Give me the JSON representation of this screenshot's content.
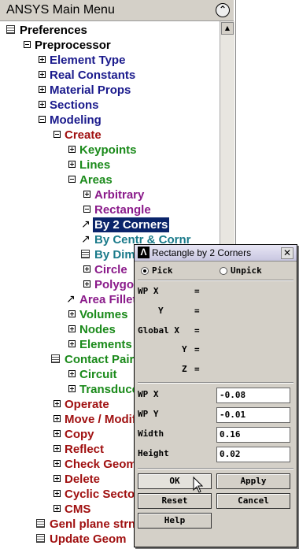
{
  "menu": {
    "title": "ANSYS Main Menu",
    "items": [
      {
        "label": "Preferences",
        "color": "#000000",
        "kind": "icon"
      },
      {
        "label": "Preprocessor",
        "color": "#000000",
        "kind": "minus"
      },
      {
        "label": "Element Type",
        "color": "#1a1a8c",
        "kind": "plus"
      },
      {
        "label": "Real Constants",
        "color": "#1a1a8c",
        "kind": "plus"
      },
      {
        "label": "Material Props",
        "color": "#1a1a8c",
        "kind": "plus"
      },
      {
        "label": "Sections",
        "color": "#1a1a8c",
        "kind": "plus"
      },
      {
        "label": "Modeling",
        "color": "#1a1a8c",
        "kind": "minus"
      },
      {
        "label": "Create",
        "color": "#a01010",
        "kind": "minus"
      },
      {
        "label": "Keypoints",
        "color": "#1a8a1a",
        "kind": "plus"
      },
      {
        "label": "Lines",
        "color": "#1a8a1a",
        "kind": "plus"
      },
      {
        "label": "Areas",
        "color": "#1a8a1a",
        "kind": "minus"
      },
      {
        "label": "Arbitrary",
        "color": "#8a1a8a",
        "kind": "plus"
      },
      {
        "label": "Rectangle",
        "color": "#8a1a8a",
        "kind": "minus"
      },
      {
        "label": "By 2 Corners",
        "color": "#ffffff",
        "kind": "arrow",
        "selected": true
      },
      {
        "label": "By Centr & Cornr",
        "color": "#1a7a8a",
        "kind": "arrow"
      },
      {
        "label": "By Dimensions",
        "color": "#1a7a8a",
        "kind": "icon"
      },
      {
        "label": "Circle",
        "color": "#8a1a8a",
        "kind": "plus"
      },
      {
        "label": "Polygon",
        "color": "#8a1a8a",
        "kind": "plus"
      },
      {
        "label": "Area Fillet",
        "color": "#8a1a8a",
        "kind": "arrow"
      },
      {
        "label": "Volumes",
        "color": "#1a8a1a",
        "kind": "plus"
      },
      {
        "label": "Nodes",
        "color": "#1a8a1a",
        "kind": "plus"
      },
      {
        "label": "Elements",
        "color": "#1a8a1a",
        "kind": "plus"
      },
      {
        "label": "Contact Pair",
        "color": "#1a8a1a",
        "kind": "icon"
      },
      {
        "label": "Circuit",
        "color": "#1a8a1a",
        "kind": "plus"
      },
      {
        "label": "Transducers",
        "color": "#1a8a1a",
        "kind": "plus"
      },
      {
        "label": "Operate",
        "color": "#a01010",
        "kind": "plus"
      },
      {
        "label": "Move / Modify",
        "color": "#a01010",
        "kind": "plus"
      },
      {
        "label": "Copy",
        "color": "#a01010",
        "kind": "plus"
      },
      {
        "label": "Reflect",
        "color": "#a01010",
        "kind": "plus"
      },
      {
        "label": "Check Geom",
        "color": "#a01010",
        "kind": "plus"
      },
      {
        "label": "Delete",
        "color": "#a01010",
        "kind": "plus"
      },
      {
        "label": "Cyclic Sector",
        "color": "#a01010",
        "kind": "plus"
      },
      {
        "label": "CMS",
        "color": "#a01010",
        "kind": "plus"
      },
      {
        "label": "Genl plane strn",
        "color": "#a01010",
        "kind": "icon"
      },
      {
        "label": "Update Geom",
        "color": "#a01010",
        "kind": "icon"
      }
    ]
  },
  "dialog": {
    "title": "Rectangle by 2 Corners",
    "pick_label": "Pick",
    "unpick_label": "Unpick",
    "readout": {
      "wp_x": "WP X",
      "y": "Y",
      "global_x": "Global X",
      "z": "Z",
      "equals": "="
    },
    "fields": [
      {
        "label": "WP X",
        "value": "-0.08"
      },
      {
        "label": "WP Y",
        "value": "-0.01"
      },
      {
        "label": "Width",
        "value": "0.16"
      },
      {
        "label": "Height",
        "value": "0.02"
      }
    ],
    "buttons": {
      "ok": "OK",
      "apply": "Apply",
      "reset": "Reset",
      "cancel": "Cancel",
      "help": "Help"
    }
  }
}
